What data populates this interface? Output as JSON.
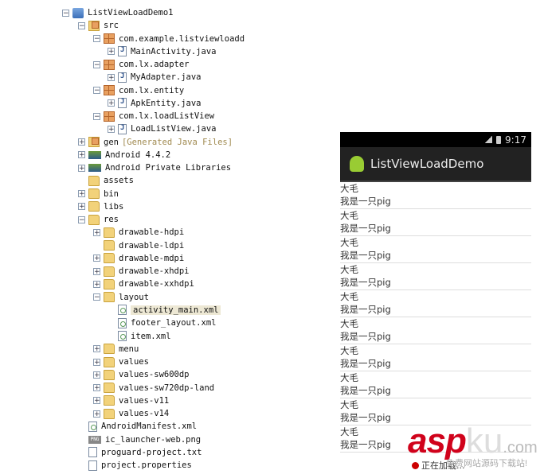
{
  "tree": [
    {
      "label": "ListViewLoadDemo1",
      "level": 0,
      "toggle": "-",
      "icon": "project"
    },
    {
      "label": "src",
      "level": 1,
      "toggle": "-",
      "icon": "srcfolder"
    },
    {
      "label": "com.example.listviewloadd",
      "level": 2,
      "toggle": "-",
      "icon": "pkg"
    },
    {
      "label": "MainActivity.java",
      "level": 3,
      "toggle": "+",
      "icon": "java"
    },
    {
      "label": "com.lx.adapter",
      "level": 2,
      "toggle": "-",
      "icon": "pkg"
    },
    {
      "label": "MyAdapter.java",
      "level": 3,
      "toggle": "+",
      "icon": "java"
    },
    {
      "label": "com.lx.entity",
      "level": 2,
      "toggle": "-",
      "icon": "pkg"
    },
    {
      "label": "ApkEntity.java",
      "level": 3,
      "toggle": "+",
      "icon": "java"
    },
    {
      "label": "com.lx.loadListView",
      "level": 2,
      "toggle": "-",
      "icon": "pkg"
    },
    {
      "label": "LoadListView.java",
      "level": 3,
      "toggle": "+",
      "icon": "java"
    },
    {
      "label": "gen",
      "suffix": "[Generated Java Files]",
      "level": 1,
      "toggle": "+",
      "icon": "srcfolder"
    },
    {
      "label": "Android 4.4.2",
      "level": 1,
      "toggle": "+",
      "icon": "lib"
    },
    {
      "label": "Android Private Libraries",
      "level": 1,
      "toggle": "+",
      "icon": "lib"
    },
    {
      "label": "assets",
      "level": 1,
      "toggle": "",
      "icon": "folder"
    },
    {
      "label": "bin",
      "level": 1,
      "toggle": "+",
      "icon": "folder"
    },
    {
      "label": "libs",
      "level": 1,
      "toggle": "+",
      "icon": "folder"
    },
    {
      "label": "res",
      "level": 1,
      "toggle": "-",
      "icon": "folder"
    },
    {
      "label": "drawable-hdpi",
      "level": 2,
      "toggle": "+",
      "icon": "folder"
    },
    {
      "label": "drawable-ldpi",
      "level": 2,
      "toggle": "",
      "icon": "folder"
    },
    {
      "label": "drawable-mdpi",
      "level": 2,
      "toggle": "+",
      "icon": "folder"
    },
    {
      "label": "drawable-xhdpi",
      "level": 2,
      "toggle": "+",
      "icon": "folder"
    },
    {
      "label": "drawable-xxhdpi",
      "level": 2,
      "toggle": "+",
      "icon": "folder"
    },
    {
      "label": "layout",
      "level": 2,
      "toggle": "-",
      "icon": "folder"
    },
    {
      "label": "activity_main.xml",
      "level": 3,
      "toggle": "",
      "icon": "xml",
      "selected": true
    },
    {
      "label": "footer_layout.xml",
      "level": 3,
      "toggle": "",
      "icon": "xml"
    },
    {
      "label": "item.xml",
      "level": 3,
      "toggle": "",
      "icon": "xml"
    },
    {
      "label": "menu",
      "level": 2,
      "toggle": "+",
      "icon": "folder"
    },
    {
      "label": "values",
      "level": 2,
      "toggle": "+",
      "icon": "folder"
    },
    {
      "label": "values-sw600dp",
      "level": 2,
      "toggle": "+",
      "icon": "folder"
    },
    {
      "label": "values-sw720dp-land",
      "level": 2,
      "toggle": "+",
      "icon": "folder"
    },
    {
      "label": "values-v11",
      "level": 2,
      "toggle": "+",
      "icon": "folder"
    },
    {
      "label": "values-v14",
      "level": 2,
      "toggle": "+",
      "icon": "folder"
    },
    {
      "label": "AndroidManifest.xml",
      "level": 1,
      "toggle": "",
      "icon": "xml"
    },
    {
      "label": "ic_launcher-web.png",
      "level": 1,
      "toggle": "",
      "icon": "png"
    },
    {
      "label": "proguard-project.txt",
      "level": 1,
      "toggle": "",
      "icon": "txt"
    },
    {
      "label": "project.properties",
      "level": 1,
      "toggle": "",
      "icon": "txt"
    }
  ],
  "phone": {
    "time": "9:17",
    "app_title": "ListViewLoadDemo",
    "items": [
      {
        "title": "大毛",
        "subtitle": "我是一只pig"
      },
      {
        "title": "大毛",
        "subtitle": "我是一只pig"
      },
      {
        "title": "大毛",
        "subtitle": "我是一只pig"
      },
      {
        "title": "大毛",
        "subtitle": "我是一只pig"
      },
      {
        "title": "大毛",
        "subtitle": "我是一只pig"
      },
      {
        "title": "大毛",
        "subtitle": "我是一只pig"
      },
      {
        "title": "大毛",
        "subtitle": "我是一只pig"
      },
      {
        "title": "大毛",
        "subtitle": "我是一只pig"
      },
      {
        "title": "大毛",
        "subtitle": "我是一只pig"
      },
      {
        "title": "大毛",
        "subtitle": "我是一只pig"
      }
    ],
    "footer": "正在加载..."
  },
  "watermark": {
    "brand_a": "asp",
    "brand_b": "ku",
    "domain": ".com",
    "tagline": "免费网站源码下载站!"
  }
}
